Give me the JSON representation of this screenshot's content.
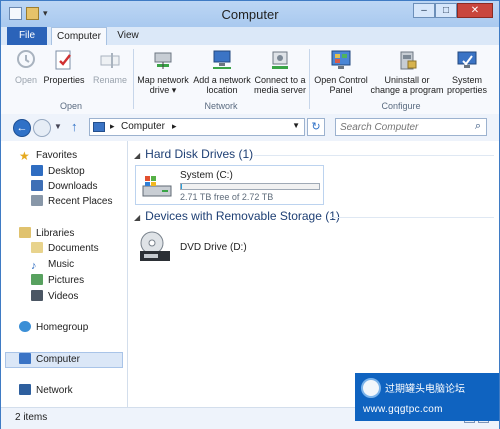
{
  "window": {
    "title": "Computer"
  },
  "tabs": {
    "file": "File",
    "computer": "Computer",
    "view": "View"
  },
  "ribbon": {
    "open": "Open",
    "properties": "Properties",
    "rename": "Rename",
    "group_location": "Open",
    "map_network_drive_l1": "Map network",
    "map_network_drive_l2": "drive ▾",
    "add_network_location_l1": "Add a network",
    "add_network_location_l2": "location",
    "connect_media_l1": "Connect to a",
    "connect_media_l2": "media server",
    "group_network": "Network",
    "control_panel_l1": "Open Control",
    "control_panel_l2": "Panel",
    "uninstall_l1": "Uninstall or",
    "uninstall_l2": "change a program",
    "system_properties_l1": "System",
    "system_properties_l2": "properties",
    "group_configure": "Configure"
  },
  "address": {
    "crumb": "Computer",
    "search_placeholder": "Search Computer"
  },
  "navpane": {
    "favorites": "Favorites",
    "desktop": "Desktop",
    "downloads": "Downloads",
    "recent_places": "Recent Places",
    "libraries": "Libraries",
    "documents": "Documents",
    "music": "Music",
    "pictures": "Pictures",
    "videos": "Videos",
    "homegroup": "Homegroup",
    "computer": "Computer",
    "network": "Network"
  },
  "content": {
    "hard_disk_header": "Hard Disk Drives (1)",
    "drive_c_label": "System (C:)",
    "drive_c_free": "2.71 TB free of 2.72 TB",
    "drive_c_used_fraction": 0.004,
    "removable_header": "Devices with Removable Storage (1)",
    "dvd_label": "DVD Drive (D:)"
  },
  "status": {
    "count": "2 items"
  },
  "watermark": {
    "site_name": "过期罐头电脑论坛",
    "url": "www.gqgtpc.com"
  }
}
